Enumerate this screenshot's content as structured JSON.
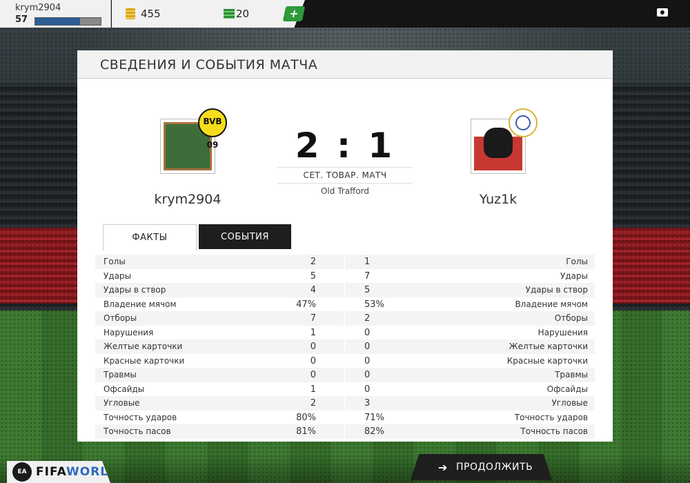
{
  "top_bar": {
    "username": "krym2904",
    "level": "57",
    "xp_progress": 0.68,
    "coins": "455",
    "points": "20",
    "add_label": "+"
  },
  "panel": {
    "title": "СВЕДЕНИЯ И СОБЫТИЯ МАТЧА"
  },
  "match": {
    "home": {
      "name": "krym2904",
      "crest": "BVB 09"
    },
    "away": {
      "name": "Yuz1k"
    },
    "score": "2 : 1",
    "type": "СЕТ. ТОВАР. МАТЧ",
    "venue": "Old Trafford"
  },
  "tabs": [
    {
      "label": "ФАКТЫ",
      "active": true
    },
    {
      "label": "СОБЫТИЯ",
      "active": false
    }
  ],
  "stats": [
    {
      "label": "Голы",
      "home": "2",
      "away": "1"
    },
    {
      "label": "Удары",
      "home": "5",
      "away": "7"
    },
    {
      "label": "Удары в створ",
      "home": "4",
      "away": "5"
    },
    {
      "label": "Владение мячом",
      "home": "47%",
      "away": "53%"
    },
    {
      "label": "Отборы",
      "home": "7",
      "away": "2"
    },
    {
      "label": "Нарушения",
      "home": "1",
      "away": "0"
    },
    {
      "label": "Желтые карточки",
      "home": "0",
      "away": "0"
    },
    {
      "label": "Красные карточки",
      "home": "0",
      "away": "0"
    },
    {
      "label": "Травмы",
      "home": "0",
      "away": "0"
    },
    {
      "label": "Офсайды",
      "home": "1",
      "away": "0"
    },
    {
      "label": "Угловые",
      "home": "2",
      "away": "3"
    },
    {
      "label": "Точность ударов",
      "home": "80%",
      "away": "71%"
    },
    {
      "label": "Точность пасов",
      "home": "81%",
      "away": "82%"
    }
  ],
  "footer": {
    "logo_prefix": "FIFA",
    "logo_suffix": "WORLD",
    "ea_badge": "EA",
    "continue_label": "ПРОДОЛЖИТЬ"
  }
}
